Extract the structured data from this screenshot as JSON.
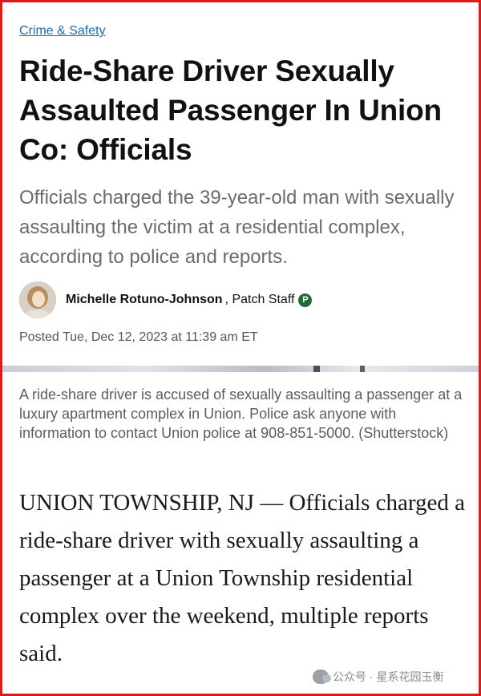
{
  "article": {
    "category": "Crime & Safety",
    "headline": "Ride-Share Driver Sexually Assaulted Passenger In Union Co: Officials",
    "dek": "Officials charged the 39-year-old man with sexually assaulting the victim at a residential complex, according to police and reports.",
    "author": "Michelle Rotuno-Johnson",
    "author_role": ", Patch Staff",
    "badge": "P",
    "posted": "Posted Tue, Dec 12, 2023 at 11:39 am ET",
    "caption": "A ride-share driver is accused of sexually assaulting a passenger at a luxury apartment complex in Union. Police ask anyone with information to contact Union police at 908-851-5000. (Shutterstock)",
    "body": "UNION TOWNSHIP, NJ — Officials charged a ride-share driver with sexually assaulting a passenger at a Union Township residential complex over the weekend, multiple reports said."
  },
  "watermark": {
    "text": "公众号 · 星系花园玉衡",
    "icon": "wechat-icon"
  },
  "colors": {
    "frame": "#e01a1a",
    "link": "#1e6ea8",
    "badge": "#1f6a37"
  }
}
